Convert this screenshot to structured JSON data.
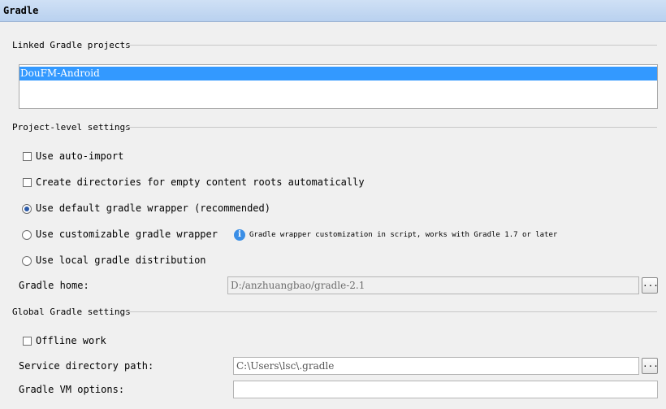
{
  "header": {
    "title": "Gradle"
  },
  "linked": {
    "section_title": "Linked Gradle projects",
    "projects": [
      "DouFM-Android"
    ]
  },
  "project_settings": {
    "section_title": "Project-level settings",
    "auto_import": {
      "label": "Use auto-import",
      "checked": false
    },
    "create_dirs": {
      "label": "Create directories for empty content roots automatically",
      "checked": false
    },
    "wrapper_options": [
      {
        "label": "Use default gradle wrapper (recommended)",
        "selected": true
      },
      {
        "label": "Use customizable gradle wrapper",
        "selected": false
      },
      {
        "label": "Use local gradle distribution",
        "selected": false
      }
    ],
    "wrapper_info": "Gradle wrapper customization in script, works with Gradle 1.7 or later",
    "gradle_home_label": "Gradle home:",
    "gradle_home_value": "D:/anzhuangbao/gradle-2.1",
    "browse_label": "..."
  },
  "global_settings": {
    "section_title": "Global Gradle settings",
    "offline_work": {
      "label": "Offline work",
      "checked": false
    },
    "service_dir_label": "Service directory path:",
    "service_dir_value": "C:\\Users\\lsc\\.gradle",
    "vm_options_label": "Gradle VM options:",
    "vm_options_value": "",
    "browse_label": "..."
  },
  "colors": {
    "header_bg": "#b9d1ef",
    "selection": "#3399ff",
    "info_icon": "#3a8ee6"
  }
}
